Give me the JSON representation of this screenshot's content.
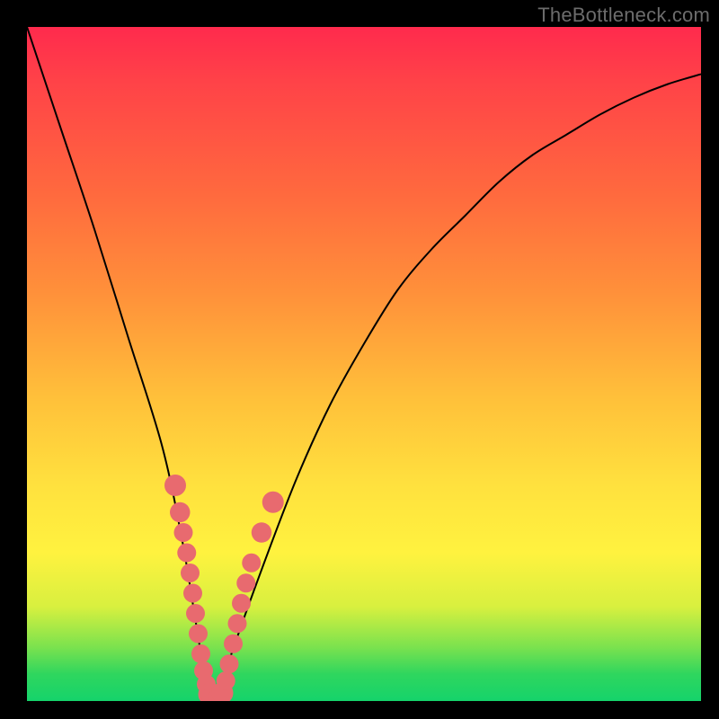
{
  "watermark": "TheBottleneck.com",
  "chart_data": {
    "type": "line",
    "title": "",
    "xlabel": "",
    "ylabel": "",
    "xlim": [
      0,
      100
    ],
    "ylim": [
      0,
      100
    ],
    "series": [
      {
        "name": "curve",
        "x": [
          0,
          5,
          10,
          15,
          20,
          23,
          25,
          26,
          27,
          28,
          29,
          30,
          35,
          40,
          45,
          50,
          55,
          60,
          65,
          70,
          75,
          80,
          85,
          90,
          95,
          100
        ],
        "values": [
          100,
          85,
          70,
          54,
          38,
          24,
          12,
          6,
          2,
          0,
          2,
          6,
          20,
          33,
          44,
          53,
          61,
          67,
          72,
          77,
          81,
          84,
          87,
          89.5,
          91.5,
          93
        ]
      }
    ],
    "markers": [
      {
        "x": 22.0,
        "y": 32.0,
        "r": 1.6
      },
      {
        "x": 22.7,
        "y": 28.0,
        "r": 1.5
      },
      {
        "x": 23.2,
        "y": 25.0,
        "r": 1.4
      },
      {
        "x": 23.7,
        "y": 22.0,
        "r": 1.4
      },
      {
        "x": 24.2,
        "y": 19.0,
        "r": 1.4
      },
      {
        "x": 24.6,
        "y": 16.0,
        "r": 1.4
      },
      {
        "x": 25.0,
        "y": 13.0,
        "r": 1.4
      },
      {
        "x": 25.4,
        "y": 10.0,
        "r": 1.4
      },
      {
        "x": 25.8,
        "y": 7.0,
        "r": 1.4
      },
      {
        "x": 26.2,
        "y": 4.5,
        "r": 1.4
      },
      {
        "x": 26.6,
        "y": 2.5,
        "r": 1.4
      },
      {
        "x": 27.0,
        "y": 1.0,
        "r": 1.6
      },
      {
        "x": 27.5,
        "y": 0.5,
        "r": 1.6
      },
      {
        "x": 28.0,
        "y": 0.3,
        "r": 1.6
      },
      {
        "x": 28.5,
        "y": 0.5,
        "r": 1.6
      },
      {
        "x": 29.0,
        "y": 1.2,
        "r": 1.6
      },
      {
        "x": 29.5,
        "y": 3.0,
        "r": 1.4
      },
      {
        "x": 30.0,
        "y": 5.5,
        "r": 1.4
      },
      {
        "x": 30.6,
        "y": 8.5,
        "r": 1.4
      },
      {
        "x": 31.2,
        "y": 11.5,
        "r": 1.4
      },
      {
        "x": 31.8,
        "y": 14.5,
        "r": 1.4
      },
      {
        "x": 32.5,
        "y": 17.5,
        "r": 1.4
      },
      {
        "x": 33.3,
        "y": 20.5,
        "r": 1.4
      },
      {
        "x": 34.8,
        "y": 25.0,
        "r": 1.5
      },
      {
        "x": 36.5,
        "y": 29.5,
        "r": 1.6
      }
    ],
    "marker_color": "#e86a6f",
    "curve_color": "#000000",
    "curve_width": 2.0
  }
}
